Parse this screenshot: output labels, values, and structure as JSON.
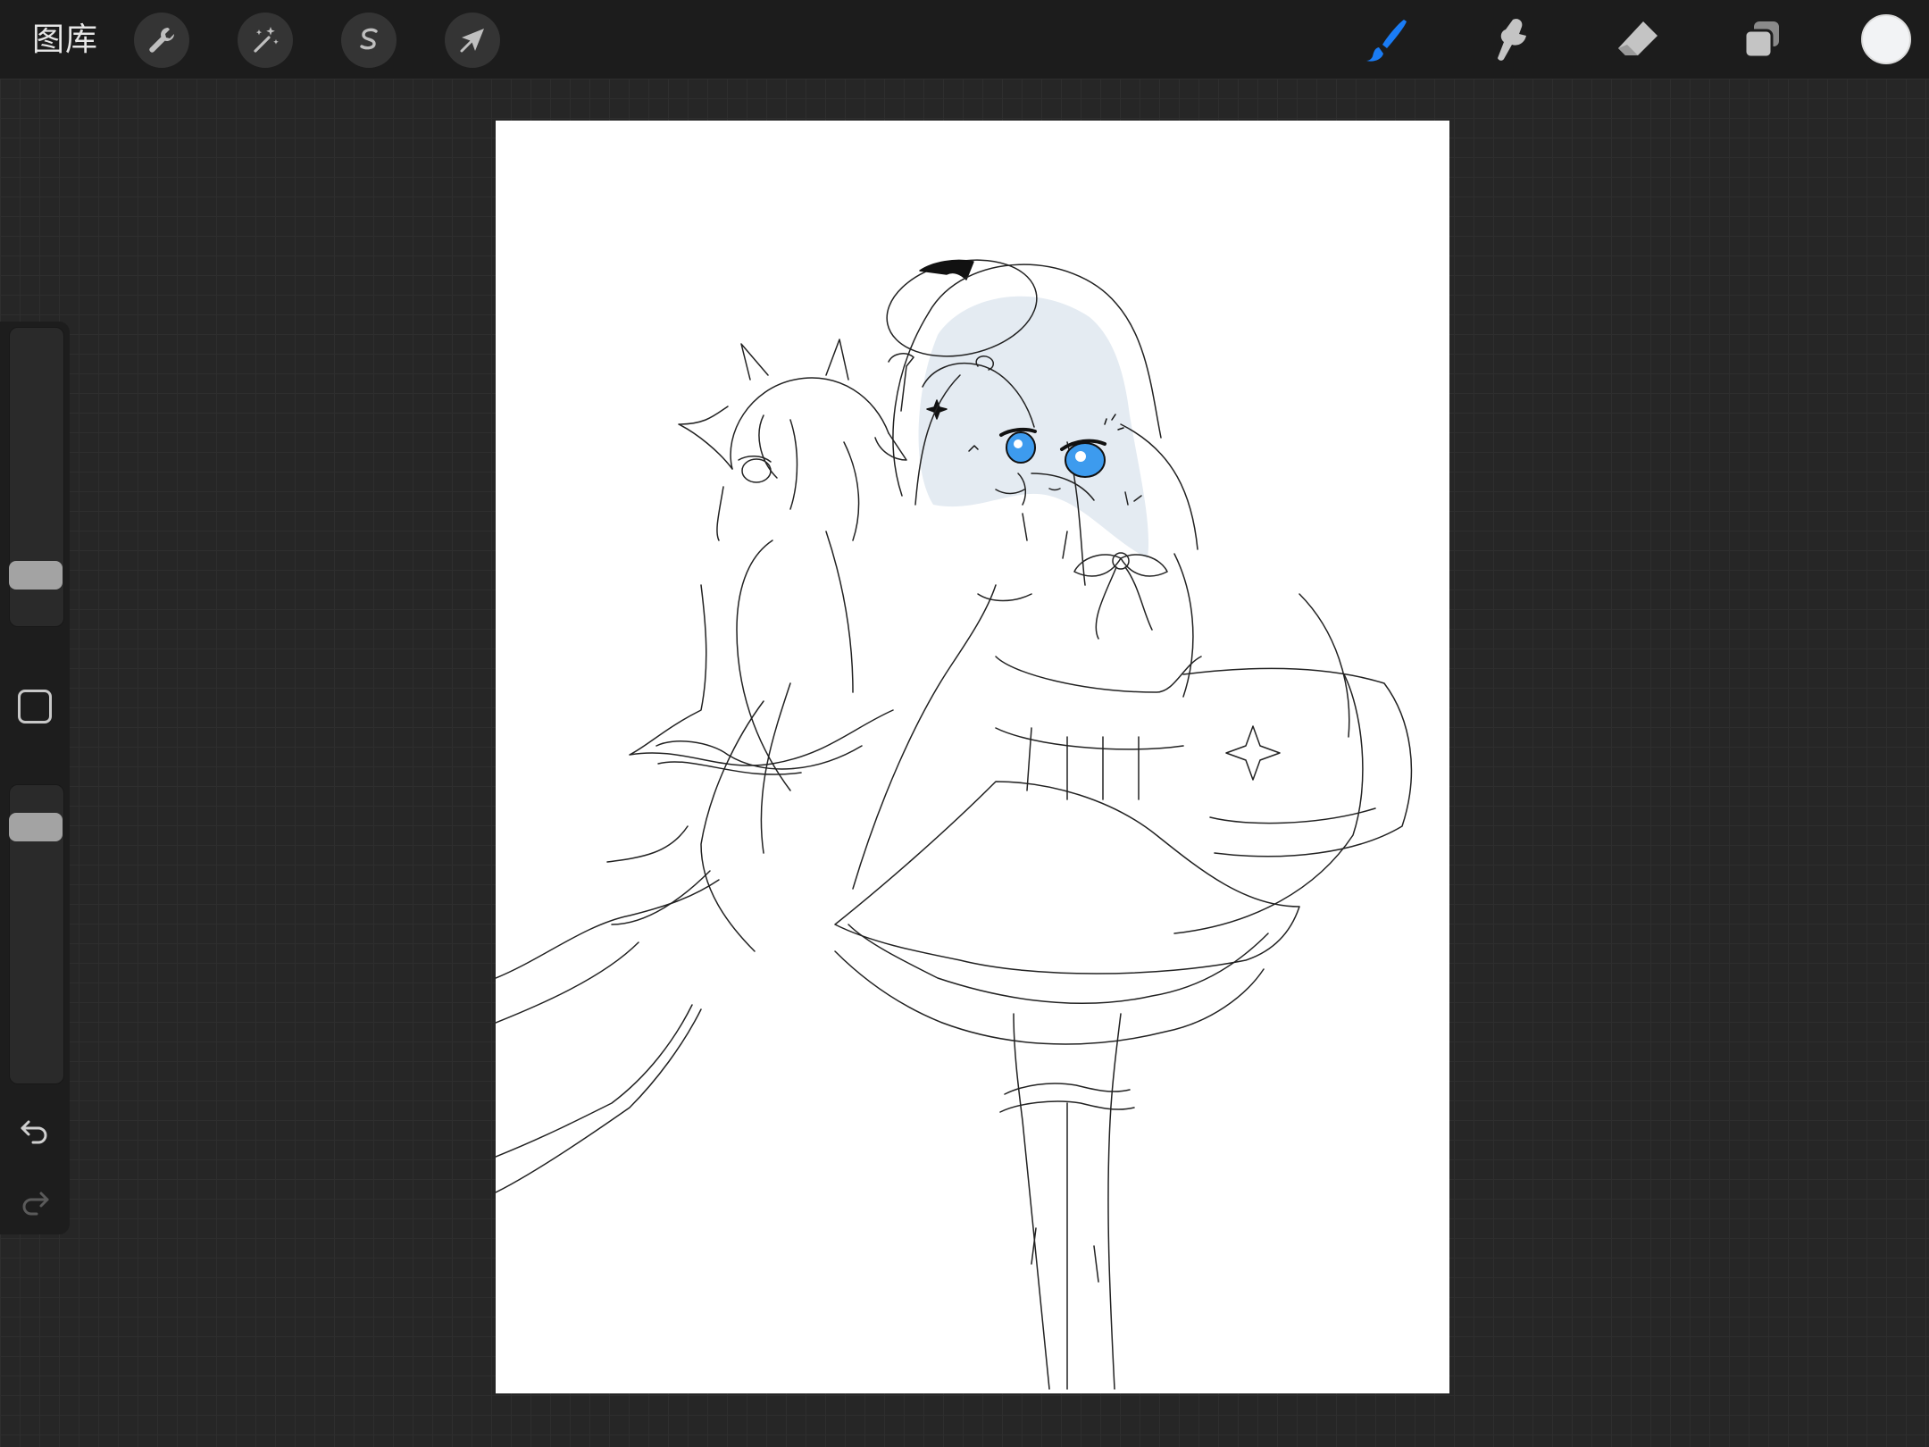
{
  "toolbar": {
    "gallery_label": "图库",
    "tools_left": [
      {
        "name": "actions",
        "icon": "wrench-icon"
      },
      {
        "name": "adjustments",
        "icon": "magic-wand-icon"
      },
      {
        "name": "selection",
        "icon": "selection-s-icon"
      },
      {
        "name": "transform",
        "icon": "arrow-cursor-icon"
      }
    ],
    "tools_right": [
      {
        "name": "brush",
        "icon": "brush-icon",
        "active": true
      },
      {
        "name": "smudge",
        "icon": "smudge-icon",
        "active": false
      },
      {
        "name": "eraser",
        "icon": "eraser-icon",
        "active": false
      },
      {
        "name": "layers",
        "icon": "layers-icon",
        "active": false
      }
    ],
    "current_color": "#f2f3f5"
  },
  "sidebar": {
    "brush_size_level": 0.22,
    "opacity_level": 0.82
  },
  "colors": {
    "accent_blue": "#1a7cf5",
    "toolbar_bg": "#1c1c1c",
    "canvas_bg": "#ffffff",
    "workspace_bg": "#262626"
  }
}
